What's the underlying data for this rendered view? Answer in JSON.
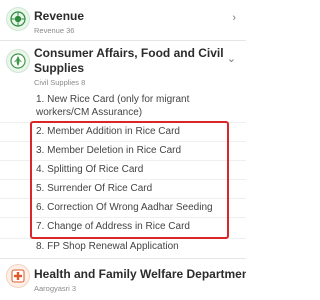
{
  "sections": [
    {
      "title": "Revenue",
      "subtitle": "Revenue 36",
      "icon": "state-emblem-icon"
    },
    {
      "title_line1": "Consumer Affairs, Food and Civil",
      "title_line2": "Supplies",
      "subtitle": "Civil Supplies 8",
      "icon": "civil-supplies-seal-icon",
      "expanded": true,
      "items": [
        "1. New Rice Card (only for migrant",
        "workers/CM Assurance)",
        "2. Member Addition in Rice Card",
        "3. Member Deletion in Rice Card",
        "4. Splitting Of Rice Card",
        "5. Surrender Of Rice Card",
        "6. Correction Of Wrong Aadhar Seeding",
        "7. Change of Address in Rice Card",
        "8. FP Shop Renewal Application"
      ]
    },
    {
      "title": "Health and Family Welfare Department",
      "subtitle": "Aarogyasri 3",
      "icon": "health-emblem-icon"
    }
  ],
  "chevrons": {
    "collapsed": "›",
    "expanded": "⌄"
  },
  "colors": {
    "highlight": "#d9262a",
    "revenue_icon": "#2e8b3d",
    "civil_icon": "#3f9a4a",
    "health_icon": "#e0592a"
  }
}
